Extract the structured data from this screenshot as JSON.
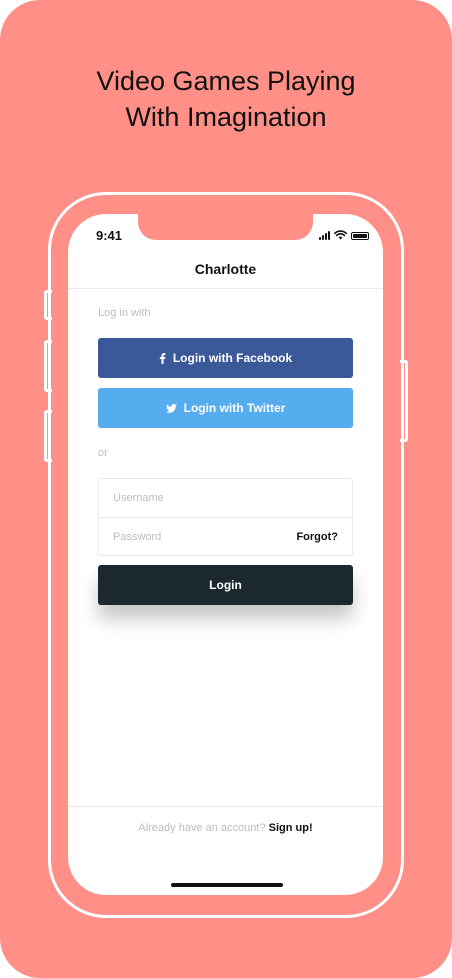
{
  "headline": {
    "line1": "Video Games Playing",
    "line2": "With Imagination"
  },
  "status_bar": {
    "time": "9:41"
  },
  "nav": {
    "title": "Charlotte"
  },
  "login": {
    "section_label": "Log in with",
    "facebook_label": "Login with Facebook",
    "twitter_label": "Login with Twitter",
    "or_label": "or",
    "username_placeholder": "Username",
    "password_placeholder": "Password",
    "forgot_label": "Forgot?",
    "login_button": "Login"
  },
  "footer": {
    "question": "Already have an account?",
    "signup": "Sign up!"
  },
  "colors": {
    "background": "#ff8f87",
    "facebook": "#3b5998",
    "twitter": "#55acee",
    "login_button": "#1c2830"
  },
  "icons": {
    "facebook": "facebook-icon",
    "twitter": "twitter-icon"
  }
}
